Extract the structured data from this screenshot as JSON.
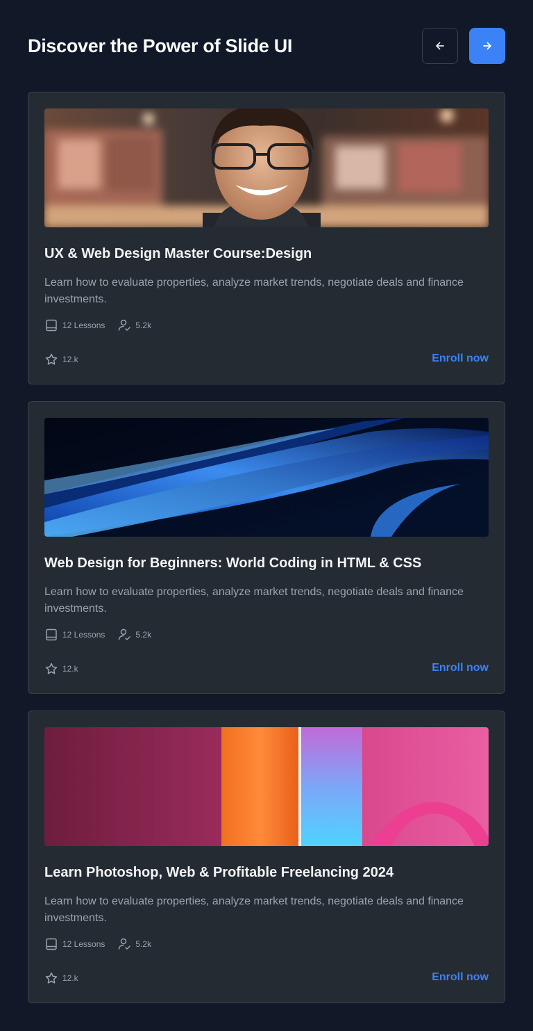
{
  "header": {
    "title": "Discover the Power of Slide UI"
  },
  "nav": {
    "prev_icon": "arrow-left-icon",
    "next_icon": "arrow-right-icon"
  },
  "colors": {
    "background": "#111827",
    "card": "#252b33",
    "accent": "#3b82f6"
  },
  "courses": [
    {
      "title": "UX & Web Design Master Course:Design",
      "description": "Learn how to evaluate properties, analyze market trends, negotiate deals and finance investments.",
      "lessons": "12 Lessons",
      "students": "5.2k",
      "rating": "12.k",
      "cta": "Enroll now"
    },
    {
      "title": "Web Design for Beginners: World Coding in HTML & CSS",
      "description": "Learn how to evaluate properties, analyze market trends, negotiate deals and finance investments.",
      "lessons": "12 Lessons",
      "students": "5.2k",
      "rating": "12.k",
      "cta": "Enroll now"
    },
    {
      "title": "Learn Photoshop, Web & Profitable Freelancing 2024",
      "description": "Learn how to evaluate properties, analyze market trends, negotiate deals and finance investments.",
      "lessons": "12 Lessons",
      "students": "5.2k",
      "rating": "12.k",
      "cta": "Enroll now"
    }
  ]
}
